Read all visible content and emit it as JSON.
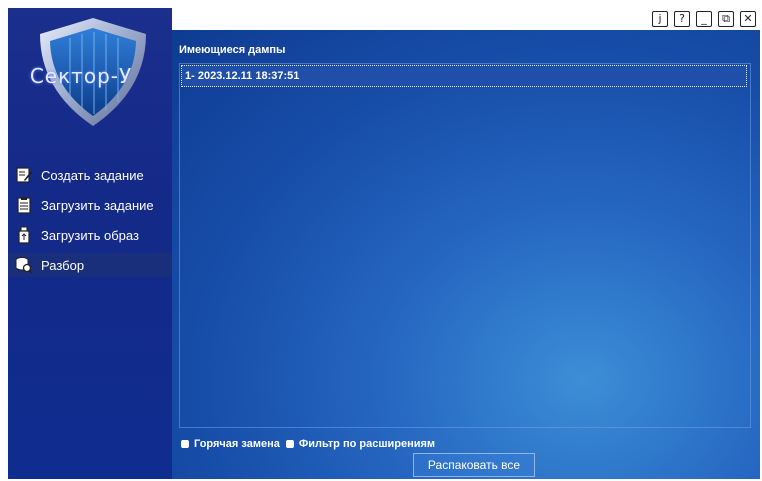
{
  "window": {
    "buttons": [
      {
        "name": "info",
        "glyph": "j"
      },
      {
        "name": "help",
        "glyph": "?"
      },
      {
        "name": "minimize",
        "glyph": "_"
      },
      {
        "name": "restore",
        "glyph": "⧉"
      },
      {
        "name": "close",
        "glyph": "✕"
      }
    ]
  },
  "logo": {
    "text": "Сектор-У"
  },
  "sidebar": {
    "items": [
      {
        "label": "Создать задание",
        "icon": "edit-document-icon",
        "active": false
      },
      {
        "label": "Загрузить задание",
        "icon": "task-list-icon",
        "active": false
      },
      {
        "label": "Загрузить образ",
        "icon": "usb-drive-icon",
        "active": false
      },
      {
        "label": "Разбор",
        "icon": "database-search-icon",
        "active": true
      }
    ]
  },
  "main": {
    "title": "Имеющиеся дампы",
    "dumps": [
      "1- 2023.12.11 18:37:51"
    ],
    "options": [
      {
        "label": "Горячая замена"
      },
      {
        "label": "Фильтр по расширениям"
      }
    ],
    "unpack_label": "Распаковать все"
  },
  "colors": {
    "sidebar": "#142a88",
    "main_center": "#3c8ed6",
    "main_edge": "#0f3b92"
  }
}
